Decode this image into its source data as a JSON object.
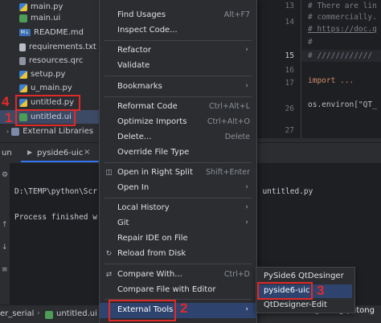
{
  "project_tree": {
    "items": [
      {
        "label": "main.py",
        "icon": "python-file-icon"
      },
      {
        "label": "main.ui",
        "icon": "ui-file-icon"
      },
      {
        "label": "README.md",
        "icon": "markdown-file-icon",
        "badge": "M↓"
      },
      {
        "label": "requirements.txt",
        "icon": "text-file-icon"
      },
      {
        "label": "resources.qrc",
        "icon": "qrc-file-icon"
      },
      {
        "label": "setup.py",
        "icon": "python-file-icon"
      },
      {
        "label": "u_main.py",
        "icon": "python-file-icon"
      },
      {
        "label": "untitled.py",
        "icon": "python-file-icon"
      },
      {
        "label": "untitled.ui",
        "icon": "ui-file-icon"
      },
      {
        "label": "External Libraries",
        "icon": "library-icon"
      }
    ],
    "annotations": {
      "untitled_py": "4",
      "untitled_ui": "1"
    }
  },
  "context_menu": {
    "groups": [
      [
        {
          "label": "Find Usages",
          "shortcut": "Alt+F7"
        },
        {
          "label": "Inspect Code..."
        }
      ],
      [
        {
          "label": "Refactor",
          "submenu": true
        },
        {
          "label": "Validate"
        }
      ],
      [
        {
          "label": "Bookmarks",
          "submenu": true
        }
      ],
      [
        {
          "label": "Reformat Code",
          "shortcut": "Ctrl+Alt+L"
        },
        {
          "label": "Optimize Imports",
          "shortcut": "Ctrl+Alt+O"
        },
        {
          "label": "Delete...",
          "shortcut": "Delete"
        },
        {
          "label": "Override File Type"
        }
      ],
      [
        {
          "label": "Open in Right Split",
          "shortcut": "Shift+Enter",
          "icon": "split-icon"
        },
        {
          "label": "Open In",
          "submenu": true
        }
      ],
      [
        {
          "label": "Local History",
          "submenu": true
        },
        {
          "label": "Git",
          "submenu": true
        },
        {
          "label": "Repair IDE on File"
        },
        {
          "label": "Reload from Disk",
          "icon": "reload-icon"
        }
      ],
      [
        {
          "label": "Compare With...",
          "shortcut": "Ctrl+D",
          "icon": "compare-icon"
        },
        {
          "label": "Compare File with Editor"
        }
      ],
      [
        {
          "label": "External Tools",
          "submenu": true,
          "highlighted": true
        }
      ]
    ],
    "annotations": {
      "external_tools": "2"
    }
  },
  "submenu": {
    "items": [
      {
        "label": "PySide6 QtDesinger"
      },
      {
        "label": "pyside6-uic",
        "highlighted": true
      },
      {
        "label": "QtDesigner-Edit"
      }
    ],
    "annotations": {
      "pyside6_uic": "3"
    }
  },
  "editor": {
    "line_numbers": [
      "13",
      "14",
      "15",
      "16",
      "17",
      "26",
      "27"
    ],
    "current_line": "15",
    "lines": [
      "# There are lin",
      "# commercially.",
      "# https://doc.q",
      "#",
      "# ////////////",
      "import ...",
      "os.environ[\"QT_"
    ]
  },
  "run_panel": {
    "title": "un",
    "tab": "pyside6-uic",
    "output": [
      "D:\\TEMP\\python\\Scr",
      "o untitled.py",
      "Process finished w"
    ]
  },
  "status_bar": {
    "left": "er_serial",
    "file": "untitled.ui"
  },
  "watermark": "CSDN @mengqiutong",
  "colors": {
    "accent": "#3574f0",
    "annotation": "#e02a2a",
    "highlight": "#2e436e"
  }
}
